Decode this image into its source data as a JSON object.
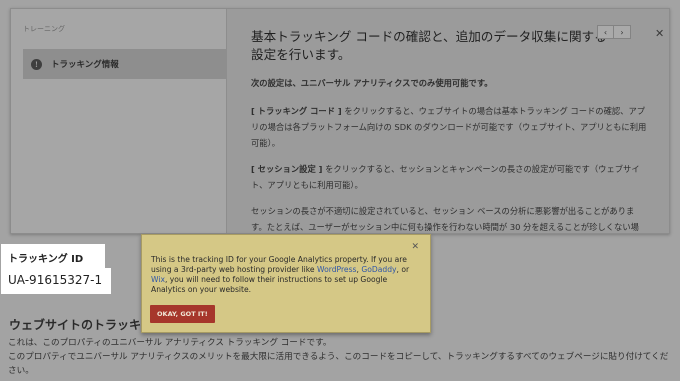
{
  "help": {
    "nav_heading": "トレーニング",
    "nav_item": "トラッキング情報",
    "title": "基本トラッキング コードの確認と、追加のデータ収集に関する設定を行います。",
    "prev_label": "‹",
    "next_label": "›",
    "close_label": "✕",
    "lead": "次の設定は、ユニバーサル アナリティクスでのみ使用可能です。",
    "p1_bold": "[ トラッキング コード ]",
    "p1": " をクリックすると、ウェブサイトの場合は基本トラッキング コードの確認、アプリの場合は各プラットフォーム向けの SDK のダウンロードが可能です（ウェブサイト、アプリともに利用可能）。",
    "p2_bold": "[ セッション設定 ]",
    "p2": " をクリックすると、セッションとキャンペーンの長さの設定が可能です（ウェブサイト、アプリともに利用可能）。",
    "p3": "セッションの長さが不適切に設定されていると、セッション ベースの分析に悪影響が出ることがあります。たとえば、ユーザーがセッション中に何も操作を行わない時間が 30 分を超えることが珍しくない場合、タイムアウトをそれよりも短く設定していると、本来 1 つのセッションのデータとなるはずが複数のセッションとして扱われてしまい、アクティビティの解釈が不"
  },
  "tracking": {
    "label": "トラッキング ID",
    "value": "UA-91615327-1"
  },
  "tooltip": {
    "close_label": "✕",
    "text_1": "This is the tracking ID for your Google Analytics property. If you are using a 3rd-party web hosting provider like ",
    "link_wordpress": "WordPress",
    "sep_1": ", ",
    "link_godaddy": "GoDaddy",
    "sep_2": ", or ",
    "link_wix": "Wix",
    "text_2": ", you will need to follow their instructions to set up Google Analytics on your website.",
    "button_label": "OKAY, GOT IT!"
  },
  "page": {
    "section_title": "ウェブサイトのトラッキン",
    "desc_line1": "これは、このプロパティのユニバーサル アナリティクス トラッキング コードです。",
    "desc_line2": "このプロパティでユニバーサル アナリティクスのメリットを最大限に活用できるよう、このコードをコピーして、トラッキングするすべてのウェブページに貼り付けてください。"
  },
  "colors": {
    "tooltip_bg": "#d5c886",
    "button_bg": "#a6362b",
    "link": "#3057a9"
  }
}
